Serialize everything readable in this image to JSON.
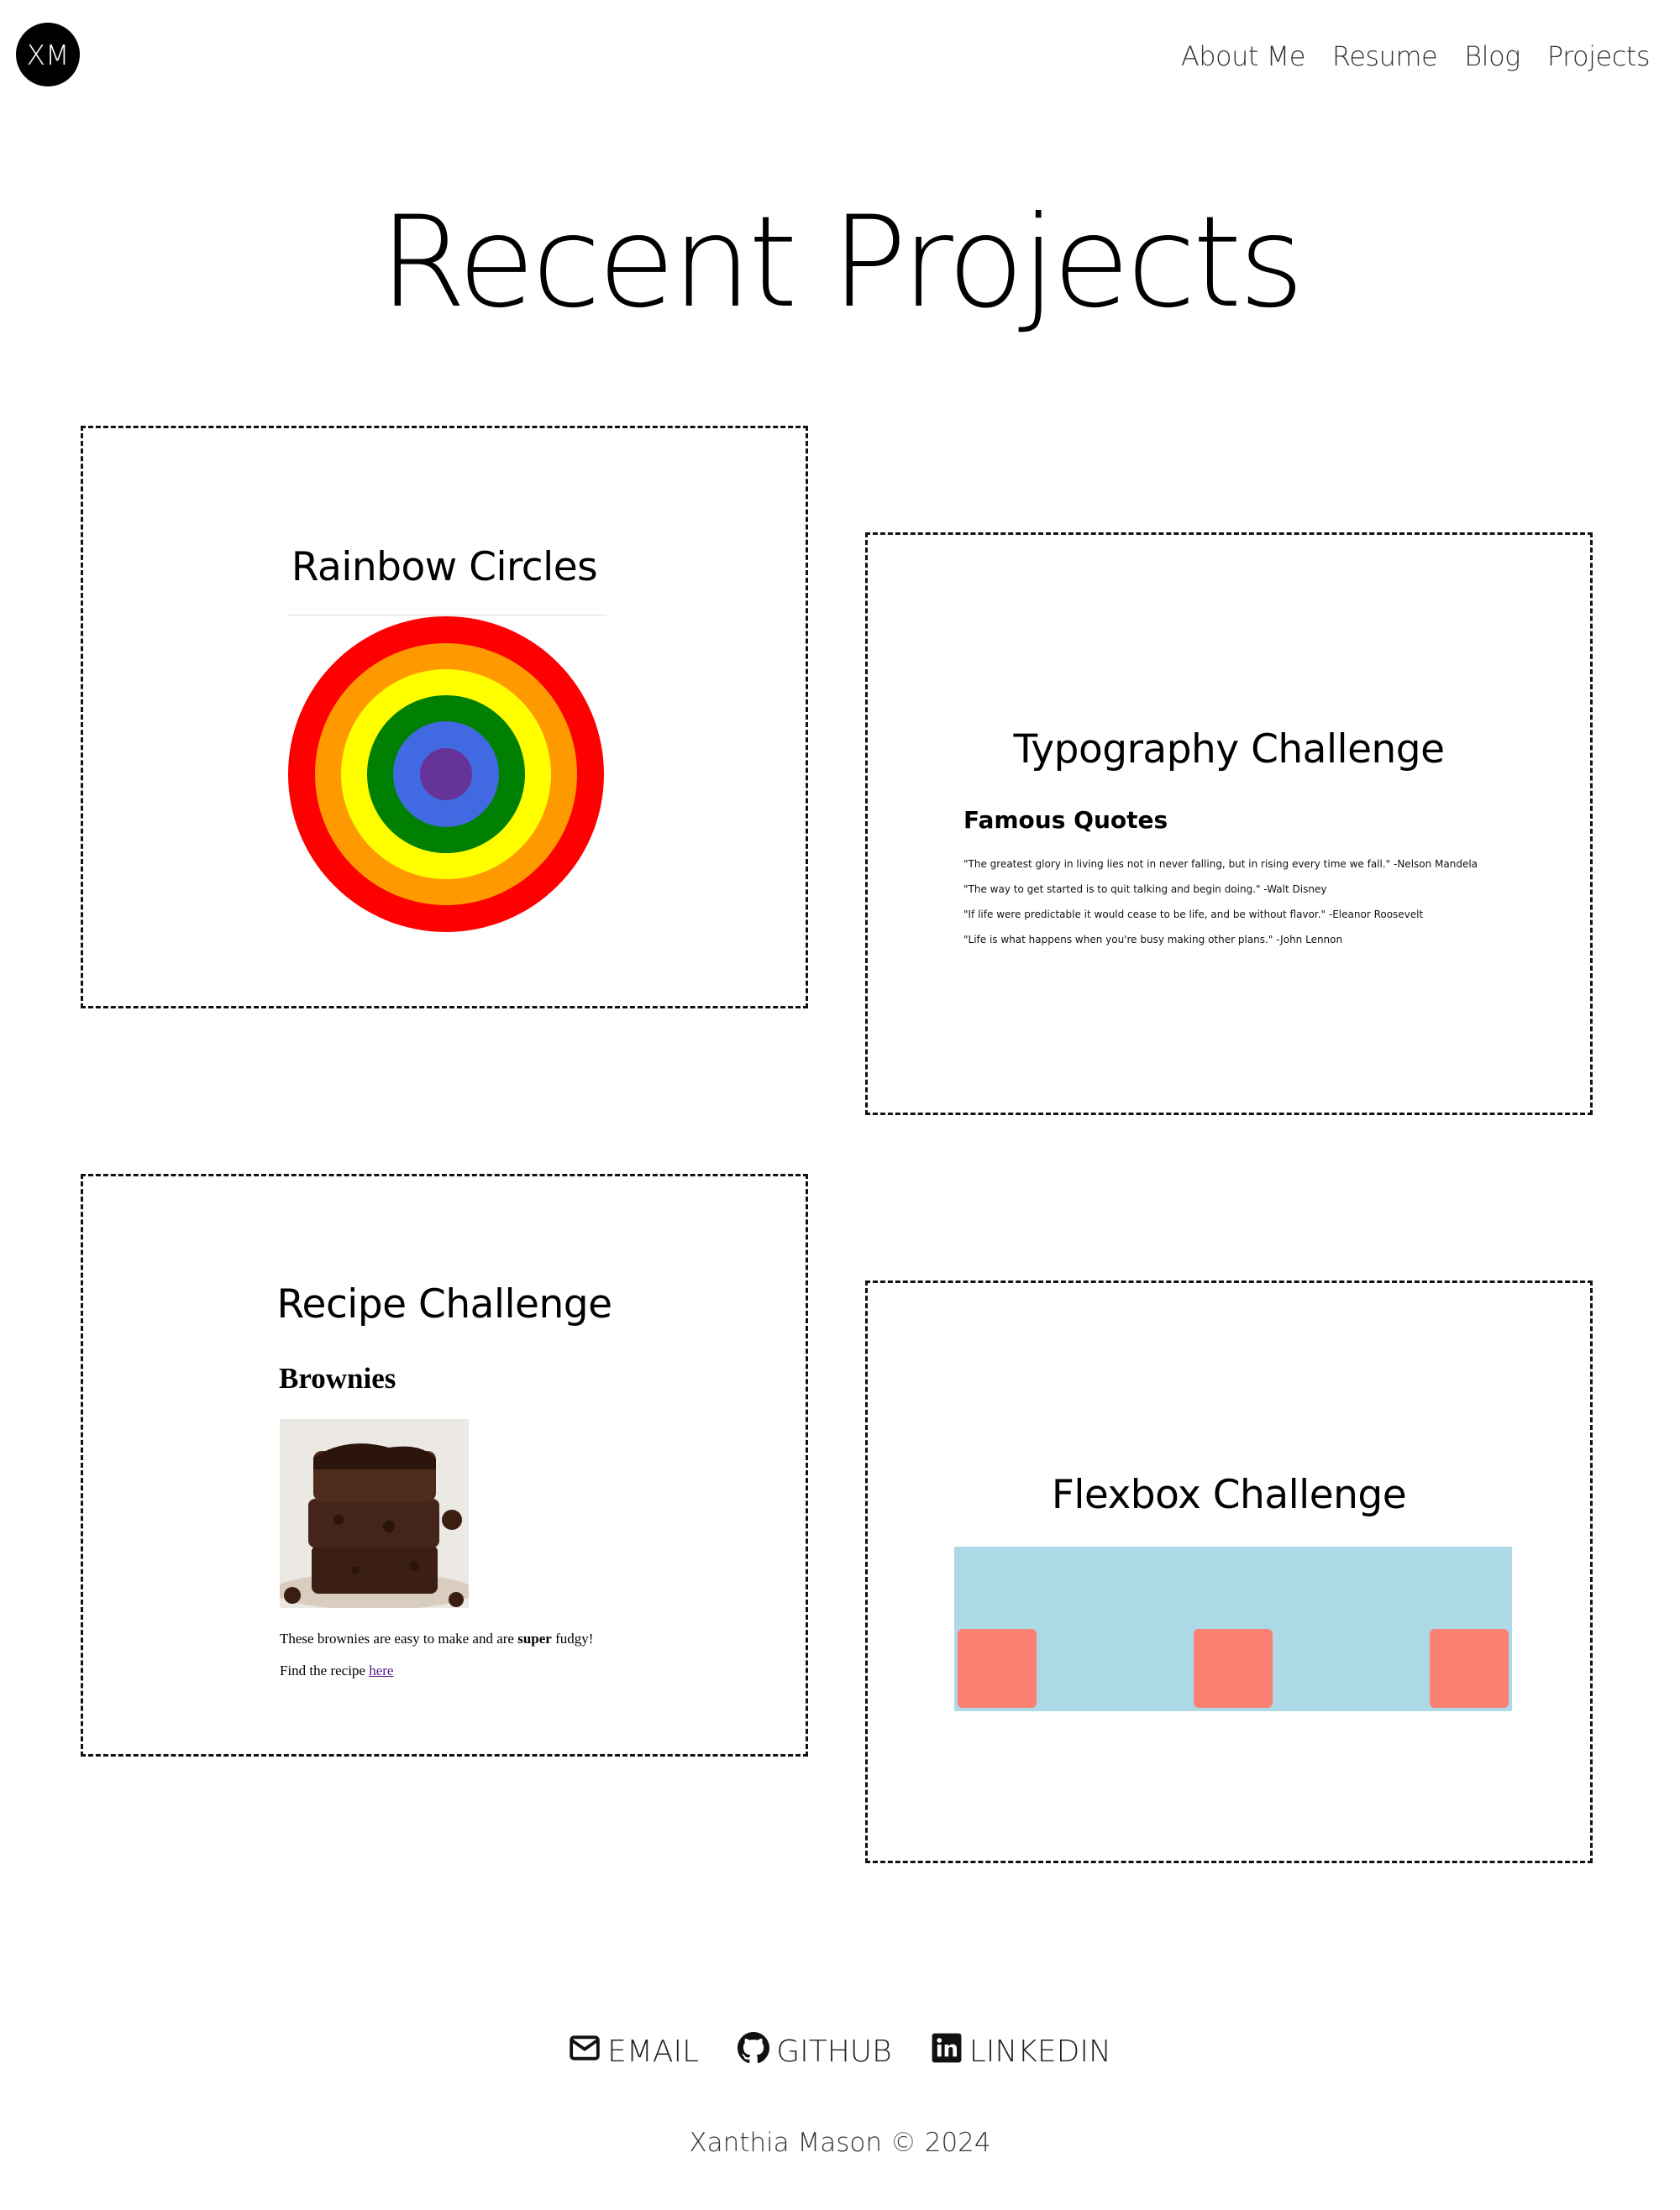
{
  "header": {
    "logo_text": "XM",
    "nav": [
      "About Me",
      "Resume",
      "Blog",
      "Projects"
    ]
  },
  "main": {
    "title": "Recent Projects",
    "projects": [
      {
        "title": "Rainbow Circles",
        "ring_colors": [
          "#ff0000",
          "#ff9900",
          "#ffff00",
          "#008000",
          "#4169e1",
          "#663399"
        ]
      },
      {
        "title": "Typography Challenge",
        "heading": "Famous Quotes",
        "quotes": [
          "\"The greatest glory in living lies not in never falling, but in rising every time we fall.\" -Nelson Mandela",
          "\"The way to get started is to quit talking and begin doing.\" -Walt Disney",
          "\"If life were predictable it would cease to be life, and be without flavor.\" -Eleanor Roosevelt",
          "\"Life is what happens when you're busy making other plans.\" -John Lennon"
        ]
      },
      {
        "title": "Recipe Challenge",
        "heading": "Brownies",
        "description_before": "These brownies are easy to make and are ",
        "description_bold": "super",
        "description_after": " fudgy!",
        "link_prefix": "Find the recipe ",
        "link_text": "here"
      },
      {
        "title": "Flexbox Challenge",
        "container_color": "#add8e6",
        "box_color": "#fa8072"
      }
    ]
  },
  "footer": {
    "links": [
      {
        "label": "EMAIL",
        "icon": "envelope-icon"
      },
      {
        "label": "GITHUB",
        "icon": "github-icon"
      },
      {
        "label": "LINKEDIN",
        "icon": "linkedin-icon"
      }
    ],
    "copyright": "Xanthia Mason © 2024"
  }
}
